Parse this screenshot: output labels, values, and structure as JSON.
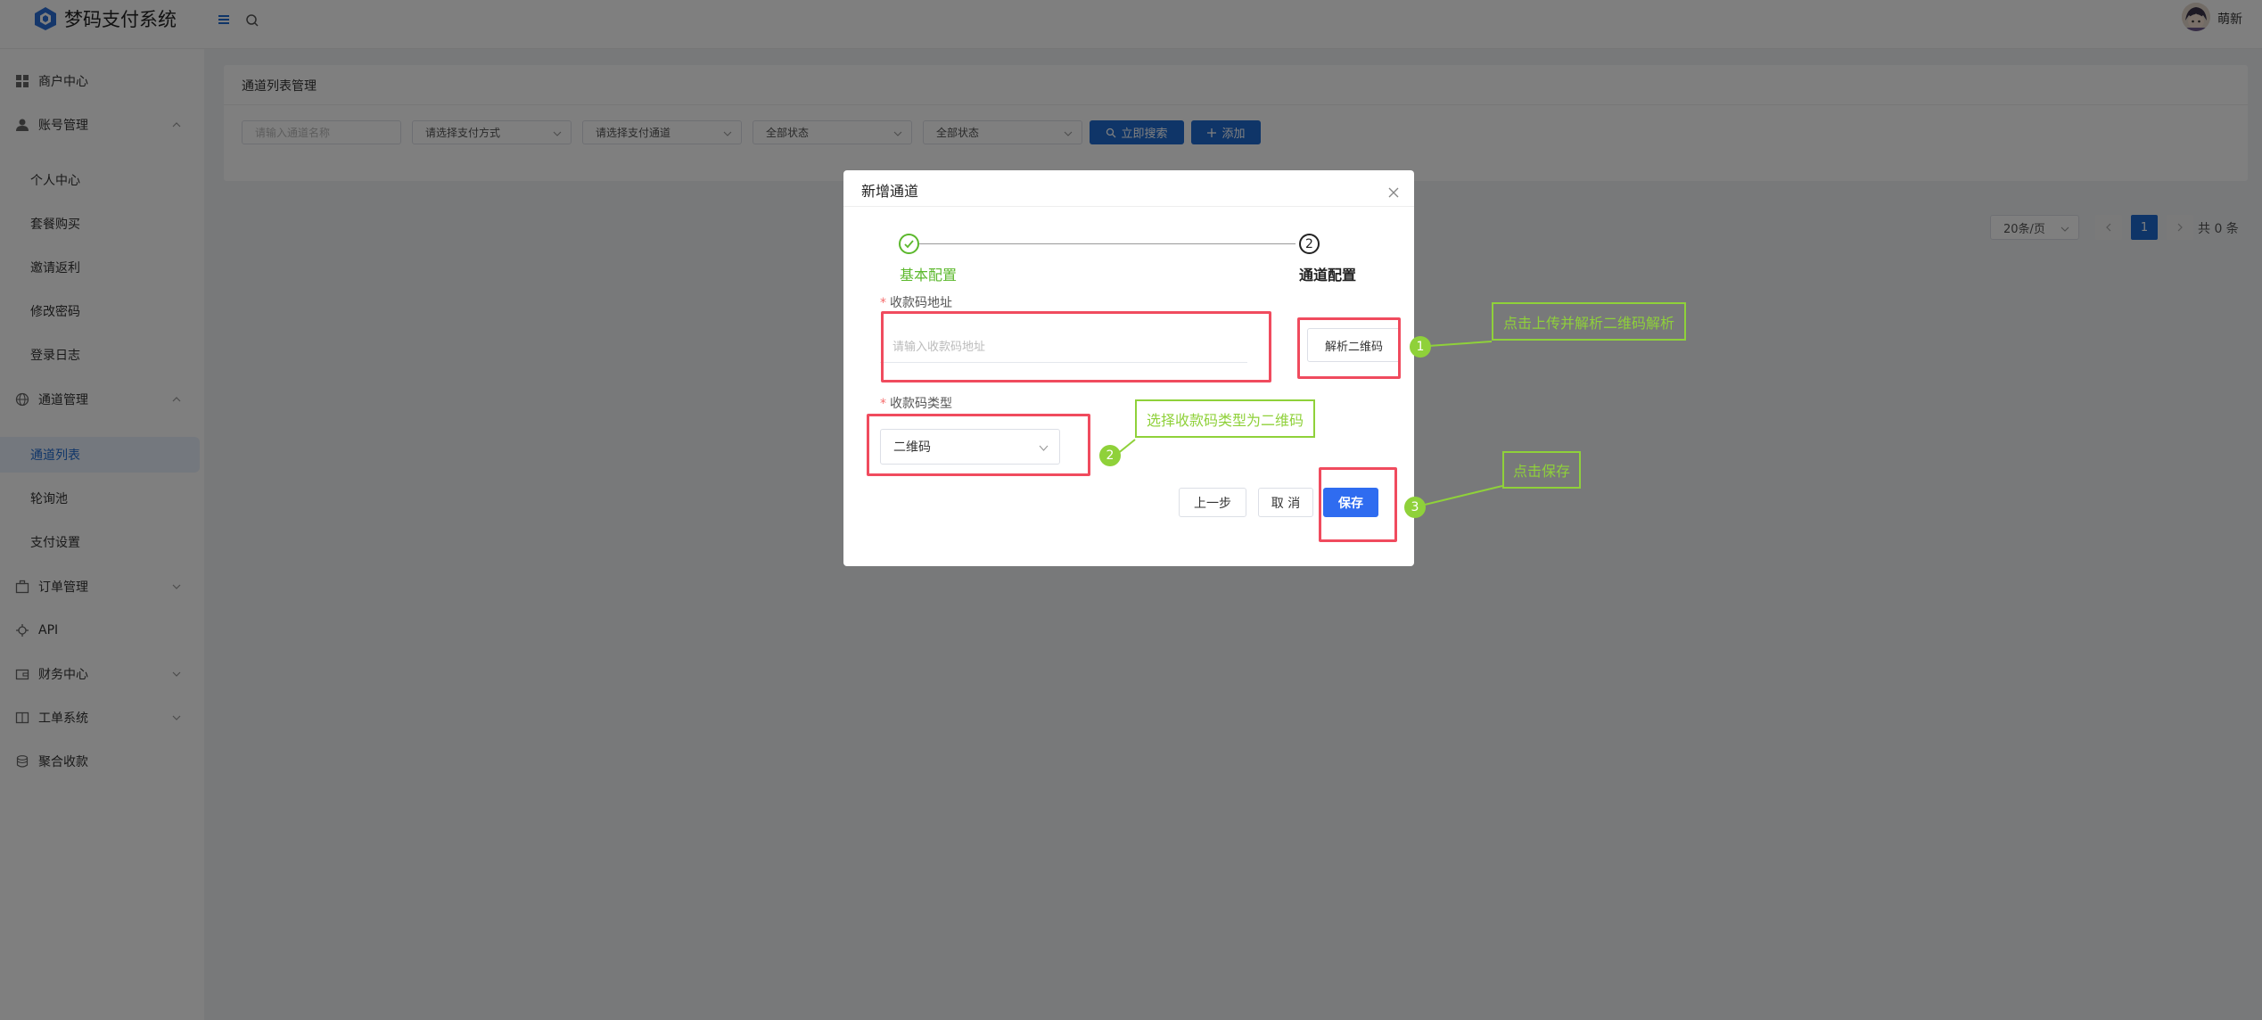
{
  "app": {
    "title": "梦码支付系统",
    "username": "萌新"
  },
  "sidebar": {
    "items": [
      {
        "label": "商户中心",
        "icon": "grid-icon"
      },
      {
        "label": "账号管理",
        "icon": "user-icon"
      },
      {
        "label": "个人中心"
      },
      {
        "label": "套餐购买"
      },
      {
        "label": "邀请返利"
      },
      {
        "label": "修改密码"
      },
      {
        "label": "登录日志"
      },
      {
        "label": "通道管理",
        "icon": "globe-icon"
      },
      {
        "label": "通道列表"
      },
      {
        "label": "轮询池"
      },
      {
        "label": "支付设置"
      },
      {
        "label": "订单管理",
        "icon": "briefcase-icon"
      },
      {
        "label": "API",
        "icon": "api-icon"
      },
      {
        "label": "财务中心",
        "icon": "wallet-icon"
      },
      {
        "label": "工单系统",
        "icon": "book-icon"
      },
      {
        "label": "聚合收款",
        "icon": "collect-icon"
      }
    ]
  },
  "page": {
    "card_title": "通道列表管理",
    "filters": {
      "name_placeholder": "请输入通道名称",
      "pay_method": "请选择支付方式",
      "channel": "请选择支付通道",
      "status1": "全部状态",
      "status2": "全部状态"
    },
    "search_label": "立即搜索",
    "add_label": "添加"
  },
  "pager": {
    "size": "20条/页",
    "current": "1",
    "total": "共 0 条"
  },
  "modal": {
    "title": "新增通道",
    "step1": "基本配置",
    "step2": "通道配置",
    "step2_num": "2",
    "url_label": "收款码地址",
    "url_placeholder": "请输入收款码地址",
    "parse_label": "解析二维码",
    "type_label": "收款码类型",
    "type_value": "二维码",
    "prev_label": "上一步",
    "cancel_label": "取 消",
    "save_label": "保存"
  },
  "annotations": {
    "a1": {
      "num": "1",
      "text": "点击上传并解析二维码解析"
    },
    "a2": {
      "num": "2",
      "text": "选择收款码类型为二维码"
    },
    "a3": {
      "num": "3",
      "text": "点击保存"
    }
  },
  "colors": {
    "primary": "#1f6bd1",
    "annotation_red": "#f04b5e",
    "annotation_green": "#8fd13a",
    "step_done": "#5cb82d"
  }
}
